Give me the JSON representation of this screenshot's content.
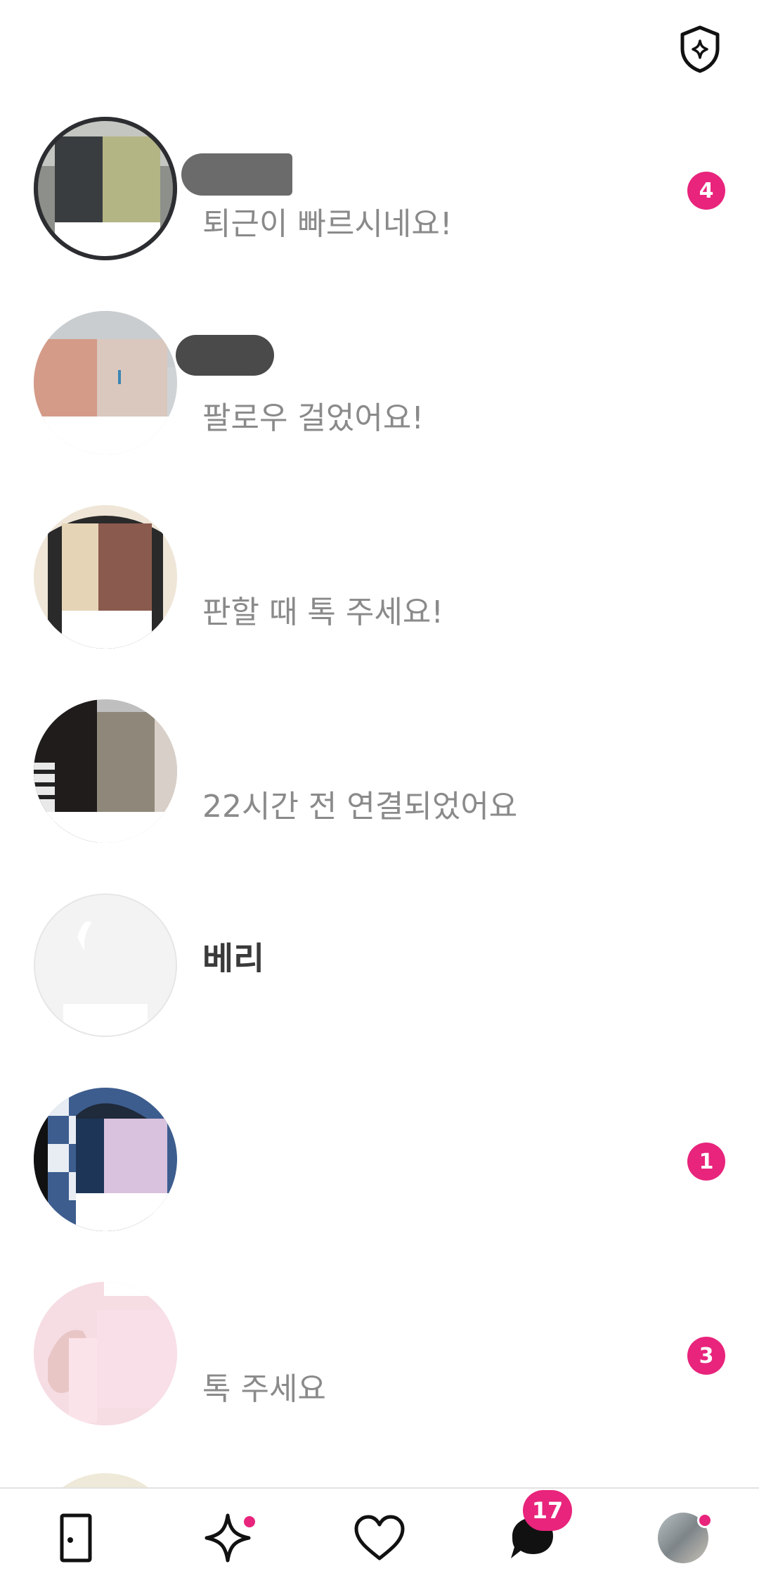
{
  "header": {
    "shield_icon": "shield-sparkle-icon"
  },
  "chats": [
    {
      "name": "",
      "preview": "퇴근이 빠르시네요!",
      "unread": "4"
    },
    {
      "name": "",
      "preview": "팔로우 걸었어요!",
      "unread": ""
    },
    {
      "name": "",
      "preview": "판할 때 톡 주세요!",
      "unread": ""
    },
    {
      "name": "",
      "preview": "22시간 전 연결되었어요",
      "unread": ""
    },
    {
      "name": "베리",
      "preview": "",
      "unread": ""
    },
    {
      "name": "",
      "preview": "",
      "unread": "1"
    },
    {
      "name": "",
      "preview": "톡 주세요",
      "unread": "3"
    }
  ],
  "bottom_nav": {
    "items": [
      {
        "icon": "door-icon"
      },
      {
        "icon": "sparkle-icon"
      },
      {
        "icon": "heart-icon"
      },
      {
        "icon": "chat-bubble-icon"
      },
      {
        "icon": "profile-avatar"
      }
    ],
    "chat_badge": "17"
  },
  "colors": {
    "accent": "#e8247c",
    "text_primary": "#3a3a3a",
    "text_secondary": "#8a8a8a"
  }
}
